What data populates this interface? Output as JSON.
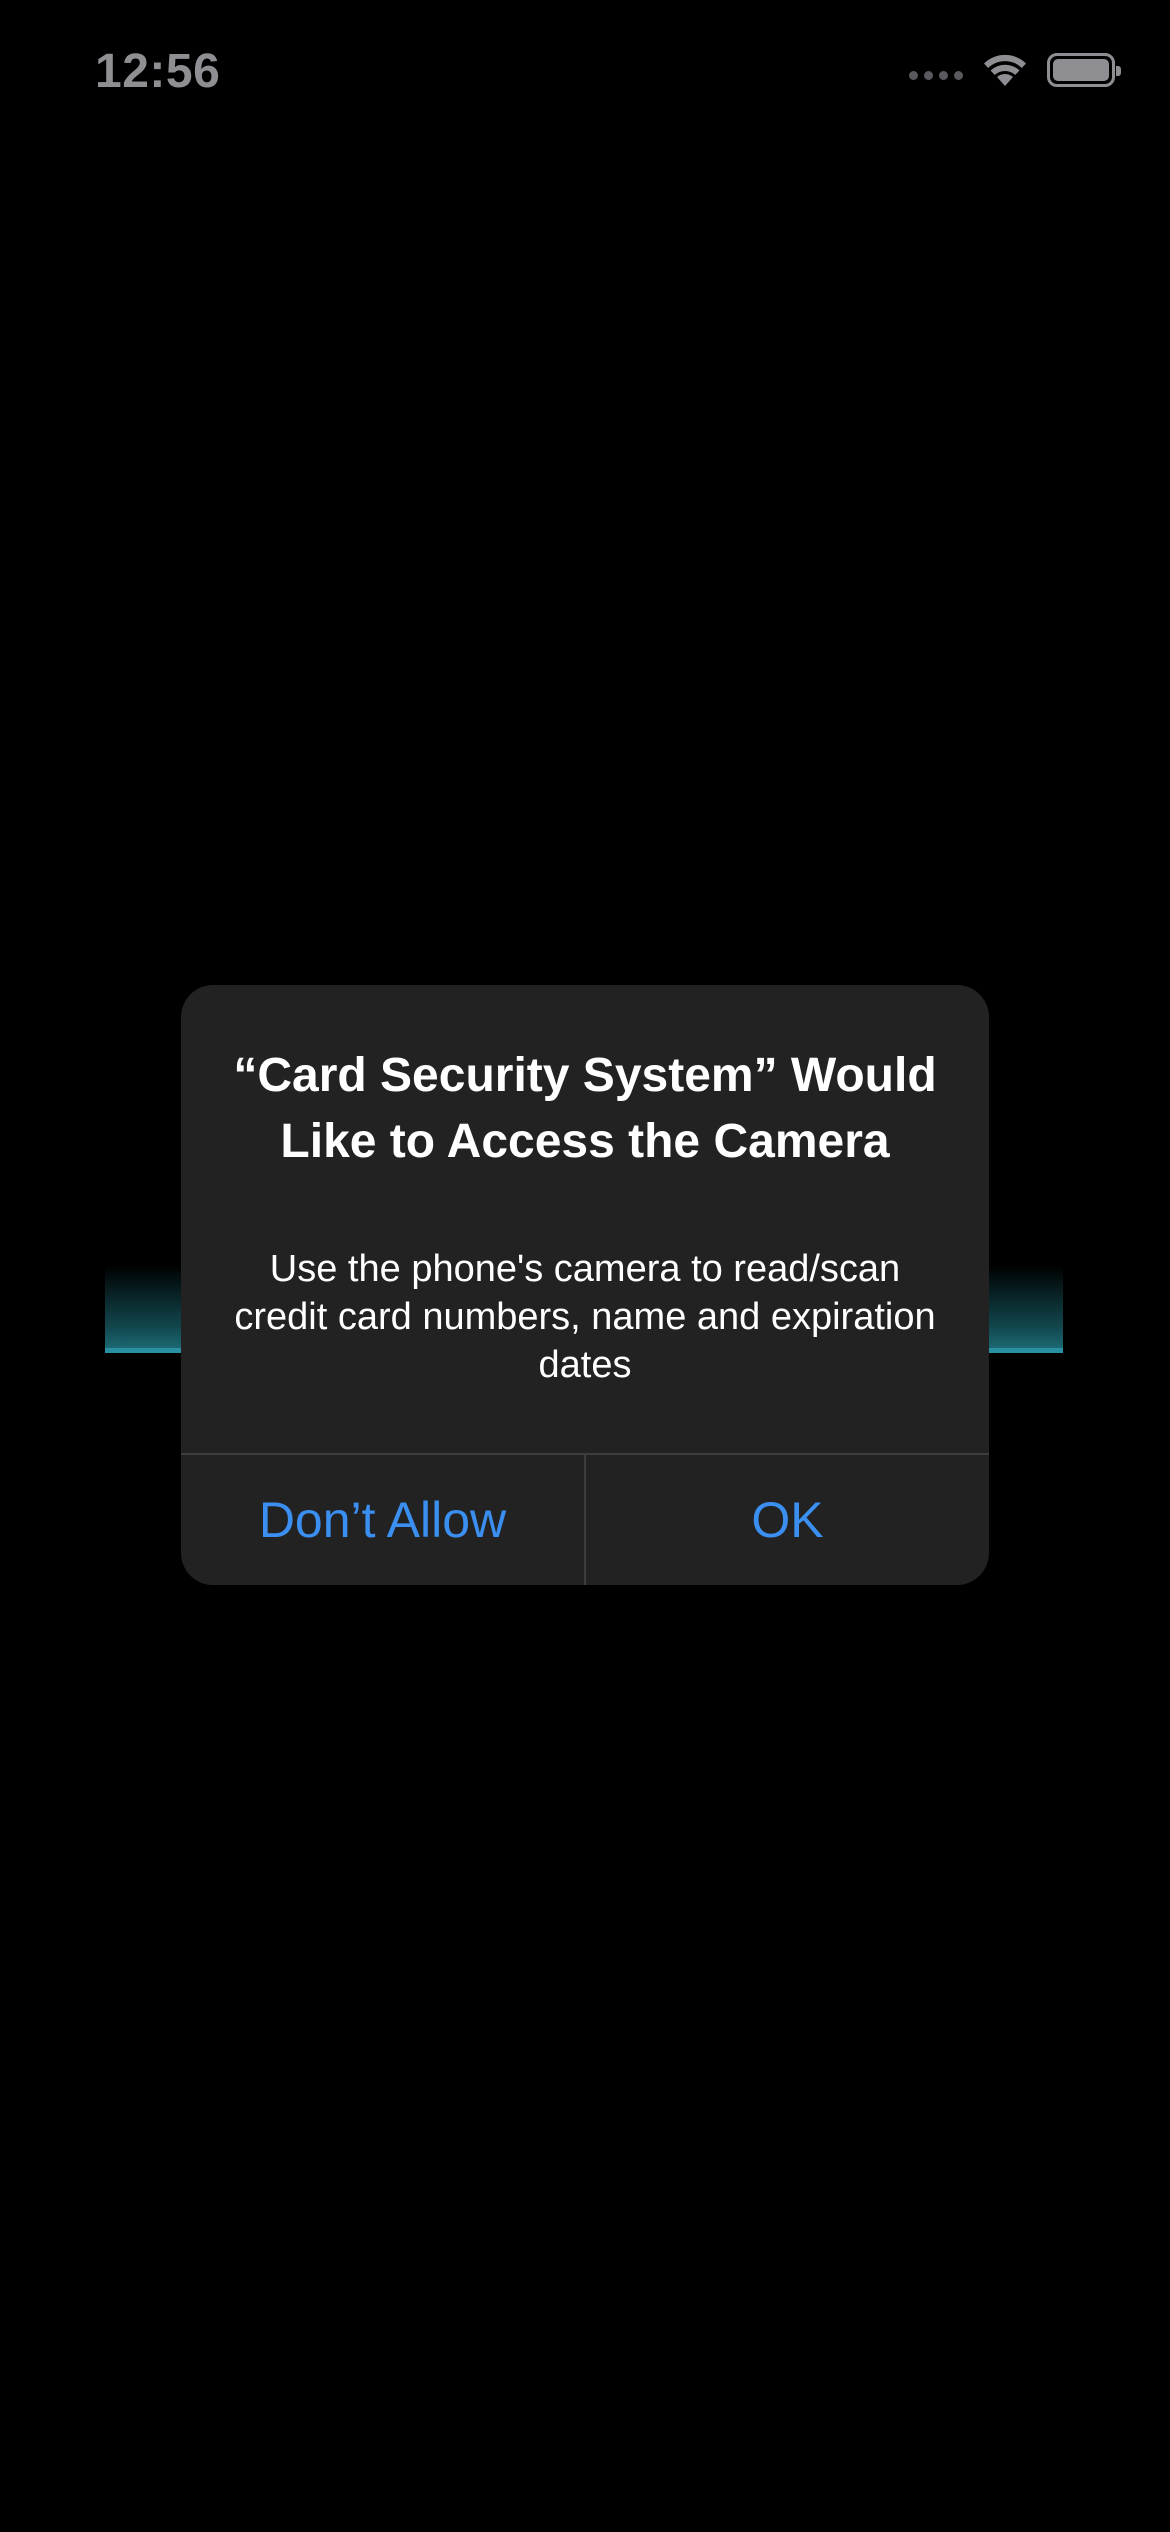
{
  "status_bar": {
    "time": "12:56",
    "icons": [
      "signal-dots-icon",
      "wifi-icon",
      "battery-icon"
    ]
  },
  "colors": {
    "background": "#000000",
    "alert_background": "#222223",
    "button_text": "#3a8ff0",
    "scan_band": "#2a8fa0"
  },
  "alert": {
    "title": "“Card Security System” Would Like to Access the Camera",
    "message": "Use the phone's camera to read/scan credit card numbers, name and expiration dates",
    "buttons": {
      "deny": "Don’t Allow",
      "allow": "OK"
    }
  }
}
